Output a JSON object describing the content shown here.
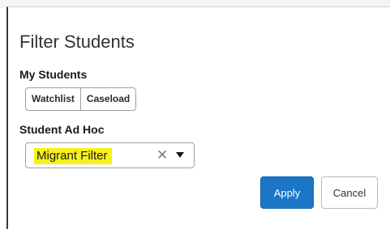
{
  "dialog": {
    "title": "Filter Students"
  },
  "my_students": {
    "label": "My Students",
    "buttons": [
      "Watchlist",
      "Caseload"
    ]
  },
  "ad_hoc": {
    "label": "Student Ad Hoc",
    "selected_value": "Migrant Filter",
    "highlight_color": "#f7f01c",
    "clear_symbol": "✕"
  },
  "actions": {
    "apply_label": "Apply",
    "cancel_label": "Cancel",
    "apply_color": "#1b76c8"
  },
  "icons": {
    "clear": "close-icon",
    "dropdown": "caret-down-icon"
  }
}
